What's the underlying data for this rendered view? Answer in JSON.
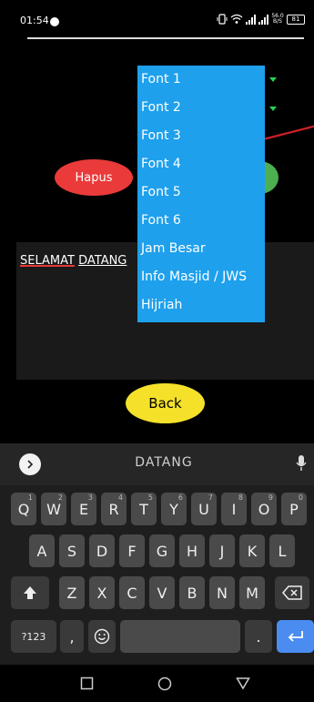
{
  "status_bar": {
    "time": "01:54",
    "speed": "56.0 B/S",
    "battery": "81"
  },
  "app": {
    "delete_button": "Hapus",
    "back_button": "Back",
    "text_area": {
      "word1": "SELAMAT",
      "word2": "DATANG"
    }
  },
  "dropdown": {
    "items": [
      "Font 1",
      "Font 2",
      "Font 3",
      "Font 4",
      "Font 5",
      "Font 6",
      "Jam Besar",
      "Info Masjid / JWS",
      "Hijriah"
    ]
  },
  "keyboard": {
    "suggestion": "DATANG",
    "row1": [
      {
        "label": "Q",
        "hint": "1"
      },
      {
        "label": "W",
        "hint": "2"
      },
      {
        "label": "E",
        "hint": "3"
      },
      {
        "label": "R",
        "hint": "4"
      },
      {
        "label": "T",
        "hint": "5"
      },
      {
        "label": "Y",
        "hint": "6"
      },
      {
        "label": "U",
        "hint": "7"
      },
      {
        "label": "I",
        "hint": "8"
      },
      {
        "label": "O",
        "hint": "9"
      },
      {
        "label": "P",
        "hint": "0"
      }
    ],
    "row2": [
      "A",
      "S",
      "D",
      "F",
      "G",
      "H",
      "J",
      "K",
      "L"
    ],
    "row3": [
      "Z",
      "X",
      "C",
      "V",
      "B",
      "N",
      "M"
    ],
    "symbols_key": "?123",
    "comma_key": ",",
    "period_key": "."
  },
  "colors": {
    "dropdown_bg": "#1ea0ec",
    "delete_button": "#ea3a3a",
    "back_button": "#f5e12a",
    "enter_key": "#4a8cf0"
  },
  "icons": [
    "expand-suggestions-icon",
    "microphone-icon",
    "shift-icon",
    "backspace-icon",
    "emoji-icon",
    "enter-icon",
    "recents-icon",
    "home-icon",
    "back-nav-icon"
  ]
}
